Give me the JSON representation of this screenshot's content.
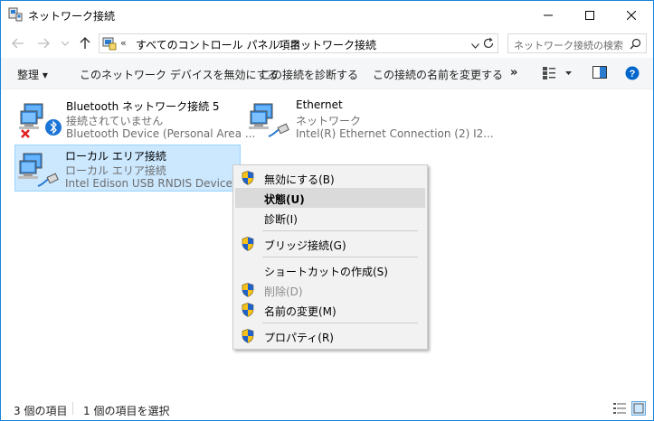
{
  "window": {
    "title": "ネットワーク接続",
    "icon": "network-connections-icon"
  },
  "address": {
    "overflow": "«",
    "crumbs": [
      "すべてのコントロール パネル項目",
      "ネットワーク接続"
    ],
    "separator": "›"
  },
  "search": {
    "placeholder": "ネットワーク接続の検索"
  },
  "commands": {
    "organize": "整理 ▾",
    "disable": "このネットワーク デバイスを無効にする",
    "diagnose": "この接続を診断する",
    "rename": "この接続の名前を変更する",
    "more": "»"
  },
  "connections": [
    {
      "name": "Bluetooth ネットワーク接続 5",
      "status": "接続されていません",
      "device": "Bluetooth Device (Personal Area ...",
      "icon": "bluetooth-network-icon",
      "selected": false
    },
    {
      "name": "Ethernet",
      "status": "ネットワーク",
      "device": "Intel(R) Ethernet Connection (2) I2...",
      "icon": "ethernet-network-icon",
      "selected": false
    },
    {
      "name": "ローカル エリア接続",
      "status": "ローカル エリア接続",
      "device": "Intel Edison USB RNDIS Device #3",
      "icon": "ethernet-network-icon",
      "selected": true
    }
  ],
  "context_menu": {
    "items": [
      {
        "label": "無効にする(B)",
        "shield": true,
        "bold": false,
        "disabled": false
      },
      {
        "label": "状態(U)",
        "shield": false,
        "bold": true,
        "disabled": false,
        "hover": true
      },
      {
        "label": "診断(I)",
        "shield": false,
        "bold": false,
        "disabled": false
      },
      {
        "label": "ブリッジ接続(G)",
        "shield": true,
        "bold": false,
        "disabled": false
      },
      {
        "label": "ショートカットの作成(S)",
        "shield": false,
        "bold": false,
        "disabled": false
      },
      {
        "label": "削除(D)",
        "shield": true,
        "bold": false,
        "disabled": true
      },
      {
        "label": "名前の変更(M)",
        "shield": true,
        "bold": false,
        "disabled": false
      },
      {
        "label": "プロパティ(R)",
        "shield": true,
        "bold": false,
        "disabled": false
      }
    ]
  },
  "status": {
    "item_count": "3 個の項目",
    "selected_count": "1 個の項目を選択"
  },
  "colors": {
    "accent": "#1883d7",
    "selection_bg": "#cce8ff",
    "selection_border": "#99d1ff",
    "menu_bg": "#f2f2f2",
    "menu_hover": "#dadada",
    "help": "#0066cc"
  }
}
